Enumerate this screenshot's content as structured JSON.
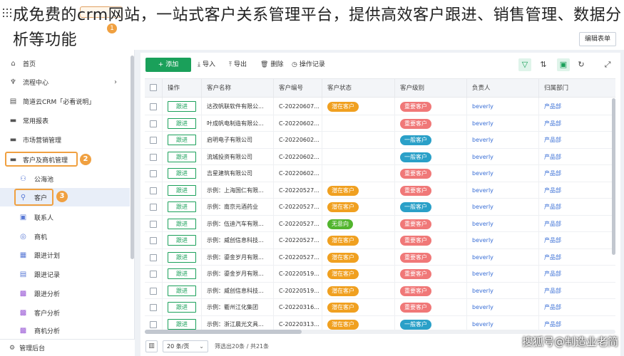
{
  "overlay": {
    "title": "成免费的crm网站，一站式客户关系管理平台，提供高效客户跟进、销售管理、数据分析等功能"
  },
  "topbar": {
    "edit_form_label": "编辑表单",
    "tab_badge": "1"
  },
  "sidebar": {
    "items": [
      {
        "label": "首页",
        "icon": "home-icon"
      },
      {
        "label": "流程中心",
        "icon": "flow-icon"
      },
      {
        "label": "简道云CRM「必看说明」",
        "icon": "doc-icon"
      },
      {
        "label": "常用报表",
        "icon": "folder-icon"
      },
      {
        "label": "市场营销管理",
        "icon": "folder-icon"
      },
      {
        "label": "客户及商机管理",
        "icon": "folder-icon"
      },
      {
        "label": "公海池",
        "icon": "users-icon"
      },
      {
        "label": "客户",
        "icon": "user-icon"
      },
      {
        "label": "联系人",
        "icon": "contact-icon"
      },
      {
        "label": "商机",
        "icon": "opportunity-icon"
      },
      {
        "label": "跟进计划",
        "icon": "plan-icon"
      },
      {
        "label": "跟进记录",
        "icon": "record-icon"
      },
      {
        "label": "跟进分析",
        "icon": "analysis-icon"
      },
      {
        "label": "客户分析",
        "icon": "analysis-icon"
      },
      {
        "label": "商机分析",
        "icon": "analysis-icon"
      }
    ],
    "badges": {
      "group": "2",
      "customer": "3"
    },
    "bottom_label": "管理后台"
  },
  "toolbar": {
    "add_label": "添加",
    "import_label": "导入",
    "export_label": "导出",
    "delete_label": "删除",
    "log_label": "操作记录"
  },
  "table": {
    "headers": [
      "操作",
      "客户名称",
      "客户编号",
      "客户状态",
      "客户级别",
      "负责人",
      "归属部门"
    ],
    "follow_label": "跟进",
    "rows": [
      {
        "name": "达孜帆联软件有限公...",
        "code": "C-20220607...",
        "status": "潜在客户",
        "level": "重要客户",
        "owner": "beverly",
        "dept": "产品部"
      },
      {
        "name": "叶成帆电制造有限公...",
        "code": "C-20220602...",
        "status": "",
        "level": "重要客户",
        "owner": "beverly",
        "dept": "产品部"
      },
      {
        "name": "启明电子有限公司",
        "code": "C-20220602...",
        "status": "",
        "level": "一般客户",
        "owner": "beverly",
        "dept": "产品部"
      },
      {
        "name": "流城投资有限公司",
        "code": "C-20220602...",
        "status": "",
        "level": "一般客户",
        "owner": "beverly",
        "dept": "产品部"
      },
      {
        "name": "吉星建筑有限公司",
        "code": "C-20220602...",
        "status": "",
        "level": "重要客户",
        "owner": "beverly",
        "dept": "产品部"
      },
      {
        "name": "示例：上海国仁有限...",
        "code": "C-20220527...",
        "status": "潜在客户",
        "level": "重要客户",
        "owner": "beverly",
        "dept": "产品部"
      },
      {
        "name": "示例：南京元酒药业",
        "code": "C-20220527...",
        "status": "潜在客户",
        "level": "一般客户",
        "owner": "beverly",
        "dept": "产品部"
      },
      {
        "name": "示例：伍迪汽车有限...",
        "code": "C-20220527...",
        "status": "无意向",
        "level": "重要客户",
        "owner": "beverly",
        "dept": "产品部"
      },
      {
        "name": "示例：威创信息科技...",
        "code": "C-20220527...",
        "status": "潜在客户",
        "level": "重要客户",
        "owner": "beverly",
        "dept": "产品部"
      },
      {
        "name": "示例：鎏金岁月有限...",
        "code": "C-20220527...",
        "status": "潜在客户",
        "level": "重要客户",
        "owner": "beverly",
        "dept": "产品部"
      },
      {
        "name": "示例：鎏金岁月有限...",
        "code": "C-20220519...",
        "status": "潜在客户",
        "level": "重要客户",
        "owner": "beverly",
        "dept": "产品部"
      },
      {
        "name": "示例：威创信息科技...",
        "code": "C-20220519...",
        "status": "潜在客户",
        "level": "重要客户",
        "owner": "beverly",
        "dept": "产品部"
      },
      {
        "name": "示例：衢州江化集团",
        "code": "C-20220316...",
        "status": "潜在客户",
        "level": "重要客户",
        "owner": "beverly",
        "dept": "产品部"
      },
      {
        "name": "示例：浙江晨光文具...",
        "code": "C-20220313...",
        "status": "潜在客户",
        "level": "一般客户",
        "owner": "beverly",
        "dept": "产品部"
      }
    ]
  },
  "colors": {
    "accent": "#1aa05a",
    "status_potential": "#f0a020",
    "status_none": "#52b52e",
    "level_important": "#f07878",
    "level_normal": "#2aa0c8",
    "link": "#3a6fd6",
    "highlight": "#f0a040"
  },
  "footer": {
    "page_size": "20 条/页",
    "count_text": "筛选出20条 / 共21条"
  },
  "watermark": "搜狐号@制造业老简"
}
